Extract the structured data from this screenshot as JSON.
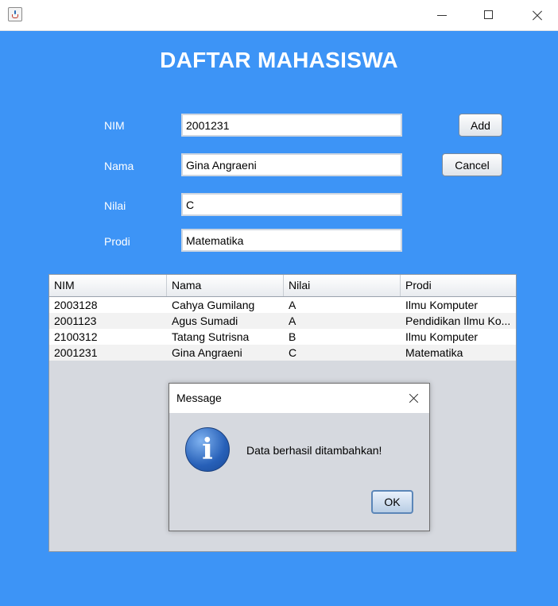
{
  "window": {
    "icon": "java-icon",
    "controls": [
      "minimize-icon",
      "maximize-icon",
      "close-icon"
    ]
  },
  "heading": "DAFTAR MAHASISWA",
  "form": {
    "nim_label": "NIM",
    "nim_value": "2001231",
    "nama_label": "Nama",
    "nama_value": "Gina Angraeni",
    "nilai_label": "Nilai",
    "nilai_value": "C",
    "prodi_label": "Prodi",
    "prodi_value": "Matematika",
    "add_label": "Add",
    "cancel_label": "Cancel"
  },
  "table": {
    "columns": [
      "NIM",
      "Nama",
      "Nilai",
      "Prodi"
    ],
    "rows": [
      [
        "2003128",
        "Cahya Gumilang",
        "A",
        "Ilmu Komputer"
      ],
      [
        "2001123",
        "Agus Sumadi",
        "A",
        "Pendidikan Ilmu Ko..."
      ],
      [
        "2100312",
        "Tatang Sutrisna",
        "B",
        "Ilmu Komputer"
      ],
      [
        "2001231",
        "Gina Angraeni",
        "C",
        "Matematika"
      ]
    ]
  },
  "dialog": {
    "title": "Message",
    "icon": "info-icon",
    "message": "Data berhasil ditambahkan!",
    "ok_label": "OK"
  },
  "colors": {
    "background": "#3d94f6",
    "heading_text": "#ffffff"
  }
}
